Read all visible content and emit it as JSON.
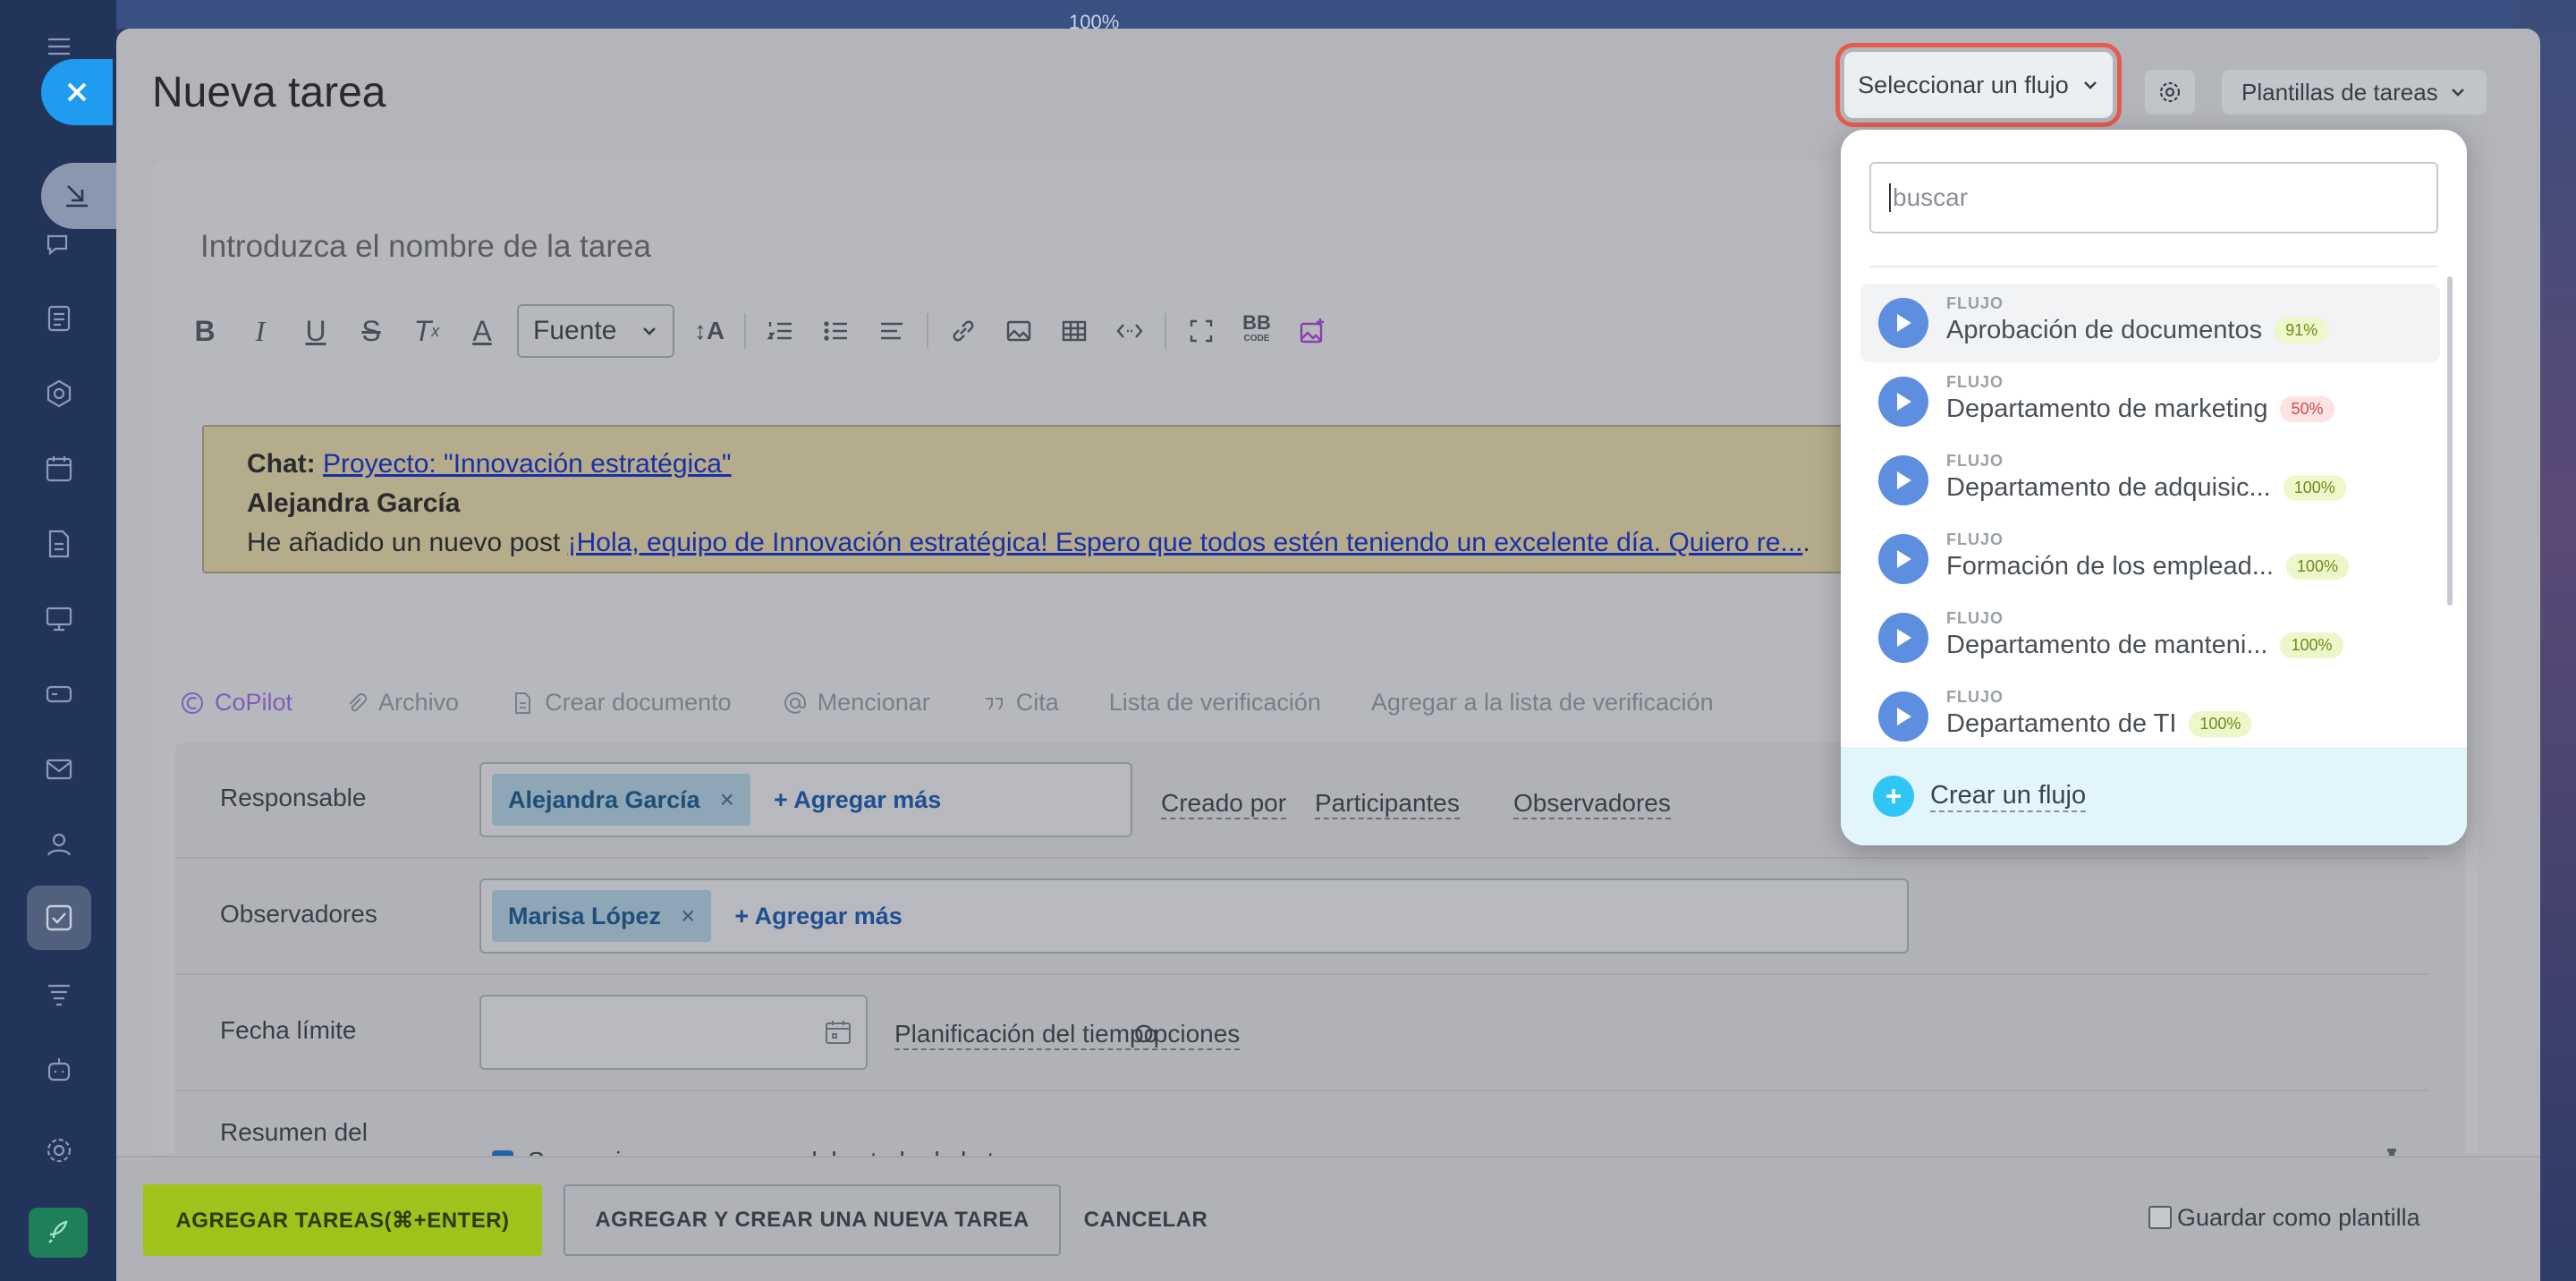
{
  "top": {
    "zoom_label": "100%"
  },
  "modal": {
    "title": "Nueva tarea",
    "flow_button": "Seleccionar un flujo",
    "templates_button": "Plantillas de tareas"
  },
  "editor": {
    "task_name_placeholder": "Introduzca el nombre de la tarea",
    "font_label": "Fuente",
    "quote": {
      "chat_label": "Chat:",
      "chat_link": "Proyecto: \"Innovación estratégica\"",
      "author": "Alejandra García",
      "prefix": "He añadido un nuevo post ",
      "post_link": "¡Hola, equipo de Innovación estratégica! Espero que todos estén teniendo un excelente día. Quiero re...",
      "suffix": "."
    },
    "actions": [
      "CoPilot",
      "Archivo",
      "Crear documento",
      "Mencionar",
      "Cita",
      "Lista de verificación",
      "Agregar a la lista de verificación"
    ]
  },
  "form": {
    "responsable": {
      "label": "Responsable",
      "chip": "Alejandra García",
      "add_more": "+ Agregar más",
      "links": [
        "Creado por",
        "Participantes",
        "Observadores"
      ]
    },
    "observadores": {
      "label": "Observadores",
      "chip": "Marisa López",
      "add_more": "+ Agregar más"
    },
    "deadline": {
      "label": "Fecha límite",
      "links": [
        "Planificación del tiempo",
        "Opciones"
      ]
    },
    "summary": {
      "label_line1": "Resumen del",
      "checkbox_text": "Se requiere un resumen del estado de la tarea"
    }
  },
  "footer": {
    "add_button": "AGREGAR TAREAS(⌘+ENTER)",
    "add_new_button": "AGREGAR Y CREAR UNA NUEVA TAREA",
    "cancel_button": "CANCELAR",
    "save_template": "Guardar como plantilla"
  },
  "dropdown": {
    "search_placeholder": "buscar",
    "caption": "FLUJO",
    "items": [
      {
        "name": "Aprobación de documentos",
        "pct": "91%",
        "badge_color": "green"
      },
      {
        "name": "Departamento de marketing",
        "pct": "50%",
        "badge_color": "red"
      },
      {
        "name": "Departamento de adquisic...",
        "pct": "100%",
        "badge_color": "green"
      },
      {
        "name": "Formación de los emplead...",
        "pct": "100%",
        "badge_color": "green"
      },
      {
        "name": "Departamento de manteni...",
        "pct": "100%",
        "badge_color": "green"
      },
      {
        "name": "Departamento de TI",
        "pct": "100%",
        "badge_color": "green"
      }
    ],
    "create_label": "Crear un flujo"
  },
  "colors": {
    "accent": "#1f9bf0",
    "highlight_outline": "#e65b4e",
    "flow_icon": "#5d8ee0",
    "create_plus": "#2fc6f6",
    "primary_button": "#9fc31a"
  }
}
